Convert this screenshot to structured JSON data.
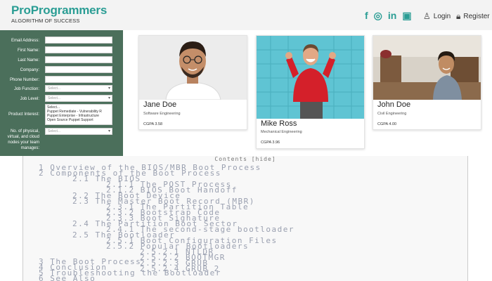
{
  "brand": {
    "name": "ProProgrammers",
    "tagline": "ALGORITHM OF SUCCESS"
  },
  "social": [
    {
      "icon": "facebook-icon",
      "glyph": "f"
    },
    {
      "icon": "instagram-icon",
      "glyph": "◎"
    },
    {
      "icon": "linkedin-icon",
      "glyph": "in"
    },
    {
      "icon": "cv-icon",
      "glyph": "▣"
    }
  ],
  "auth": {
    "login": "Login",
    "register": "Register"
  },
  "form": {
    "fields": [
      {
        "label": "Email Address:",
        "type": "text",
        "value": ""
      },
      {
        "label": "First Name:",
        "type": "text",
        "value": ""
      },
      {
        "label": "Last Name:",
        "type": "text",
        "value": ""
      },
      {
        "label": "Company:",
        "type": "text",
        "value": ""
      },
      {
        "label": "Phone Number:",
        "type": "text",
        "value": ""
      },
      {
        "label": "Job Function:",
        "type": "select",
        "value": "Select..."
      },
      {
        "label": "Job Level:",
        "type": "select",
        "value": "Select..."
      }
    ],
    "product_interest": {
      "label": "Product Interest:",
      "options": [
        "Select...",
        "Puppet Remediate - Vulnerability R",
        "Puppet Enterprise - Infrastructure",
        "Open Source Puppet Support"
      ]
    },
    "nodes": {
      "label_lines": [
        "No. of physical,",
        "virtual, and cloud",
        "nodes your team",
        "manages:"
      ],
      "value": "Select..."
    }
  },
  "cards": [
    {
      "name": "Jane Doe",
      "role": "Software Engineering",
      "gpa": "CGPA 3.58"
    },
    {
      "name": "Mike Ross",
      "role": "Mechanical Engineering",
      "gpa": "CGPA 3.96"
    },
    {
      "name": "John Doe",
      "role": "Civil Engineering",
      "gpa": "CGPA 4.00"
    }
  ],
  "doc": {
    "title": "Contents [hide]",
    "lines": [
      "1 Overview of the BIOS/MBR Boot Process",
      "2 Components of the Boot Process",
      "2.1 The BIOS",
      "2.1.1 The POST Process",
      "2.1.2 BIOS Boot Handoff",
      "2.2 The Boot Device",
      "2.3 The Master Boot Record (MBR)",
      "2.3.1 The Partition Table",
      "2.3.2 Bootstrap Code",
      "2.3.3 Boot Signature",
      "2.4 The Partition Boot Sector",
      "2.4.1 The second-stage bootloader",
      "2.5 The Bootloader",
      "2.5.1 Boot Configuration Files",
      "2.5.2 Popular Bootloaders",
      "2.5.2.1 NTLDR",
      "2.5.2.2 BOOTMGR",
      "2.5.2.3 GRUB",
      "2.5.2.4 GRUB 2",
      "3 The Boot Process",
      "4 Conclusion",
      "5 Troubleshooting the Bootloader",
      "6 See Also"
    ]
  },
  "colors": {
    "brand": "#2a9d94",
    "form_bg": "#4b6f5b"
  }
}
